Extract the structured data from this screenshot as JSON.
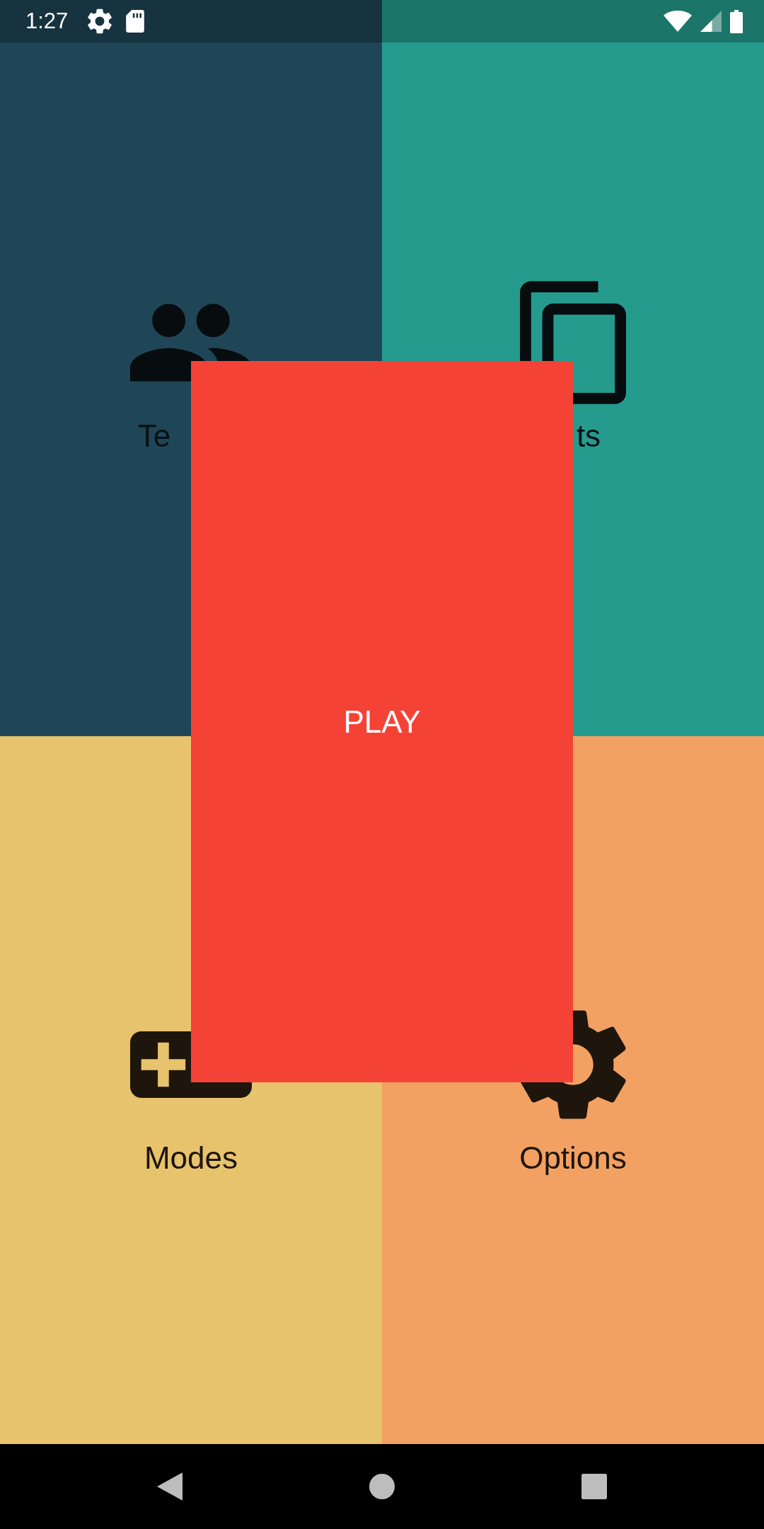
{
  "status_bar": {
    "time": "1:27"
  },
  "tiles": [
    {
      "label": "Te"
    },
    {
      "label": "ts"
    },
    {
      "label": "Modes"
    },
    {
      "label": "Options"
    }
  ],
  "play_button": {
    "label": "PLAY"
  }
}
